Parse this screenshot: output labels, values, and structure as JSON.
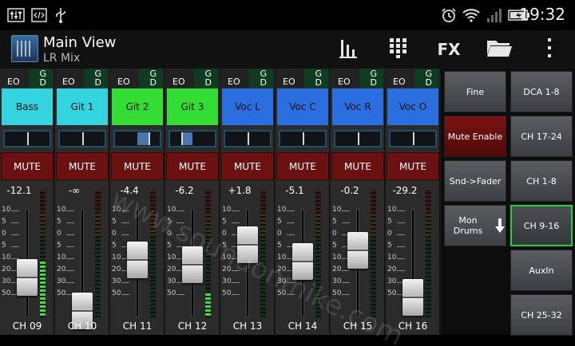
{
  "statusbar": {
    "time": "19:32",
    "icons": [
      "equalizer-notification-icon",
      "code-notification-icon",
      "usb-icon",
      "alarm-icon",
      "wifi-icon",
      "signal-icon",
      "battery-charging-icon"
    ]
  },
  "actionbar": {
    "title": "Main View",
    "subtitle": "LR Mix",
    "actions": [
      "meters-icon",
      "channel-grid-icon",
      "FX",
      "folder-icon",
      "overflow-menu-icon"
    ],
    "fx_label": "FX"
  },
  "channels": [
    {
      "name": "Bass",
      "label": "CH 09",
      "level": "-12.1",
      "color": "#34d3e0",
      "pan": 0.5,
      "fader": 0.43,
      "meter": 0.45
    },
    {
      "name": "Git 1",
      "label": "CH 10",
      "level": "-∞",
      "color": "#34d3e0",
      "pan": 0.5,
      "fader": 0.08,
      "meter": 0.0
    },
    {
      "name": "Git 2",
      "label": "CH 11",
      "level": "-4.4",
      "color": "#33dd33",
      "pan": 0.75,
      "fader": 0.62,
      "meter": 0.0
    },
    {
      "name": "Git 3",
      "label": "CH 12",
      "level": "-6.2",
      "color": "#33dd33",
      "pan": 0.25,
      "fader": 0.57,
      "meter": 0.18
    },
    {
      "name": "Voc L",
      "label": "CH 13",
      "level": "+1.8",
      "color": "#2a6ee0",
      "pan": 0.5,
      "fader": 0.78,
      "meter": 0.0
    },
    {
      "name": "Voc C",
      "label": "CH 14",
      "level": "-5.1",
      "color": "#2a6ee0",
      "pan": 0.5,
      "fader": 0.6,
      "meter": 0.0
    },
    {
      "name": "Voc R",
      "label": "CH 15",
      "level": "-0.2",
      "color": "#2a6ee0",
      "pan": 0.5,
      "fader": 0.72,
      "meter": 0.0
    },
    {
      "name": "Voc O",
      "label": "CH 16",
      "level": "-29.2",
      "color": "#2a6ee0",
      "pan": 0.5,
      "fader": 0.22,
      "meter": 0.0
    }
  ],
  "strip_labels": {
    "eo": "EO",
    "g": "G",
    "d": "D",
    "mute": "MUTE"
  },
  "scale_marks": [
    "10",
    "5",
    "0",
    "5",
    "10",
    "20",
    "30",
    "50"
  ],
  "right_panel": {
    "left": [
      {
        "label": "Fine",
        "style": "normal"
      },
      {
        "label": "Mute Enable",
        "style": "red"
      },
      {
        "label": "Snd->Fader",
        "style": "normal"
      },
      {
        "label": "Mon Drums",
        "style": "normal",
        "icon": "arrow-down-icon"
      }
    ],
    "right": [
      {
        "label": "DCA 1-8",
        "style": "normal"
      },
      {
        "label": "CH 17-24",
        "style": "normal"
      },
      {
        "label": "CH 1-8",
        "style": "normal"
      },
      {
        "label": "CH 9-16",
        "style": "selected"
      },
      {
        "label": "AuxIn",
        "style": "normal"
      },
      {
        "label": "CH 25-32",
        "style": "normal"
      }
    ]
  },
  "watermark": "www.soundonmike.com"
}
